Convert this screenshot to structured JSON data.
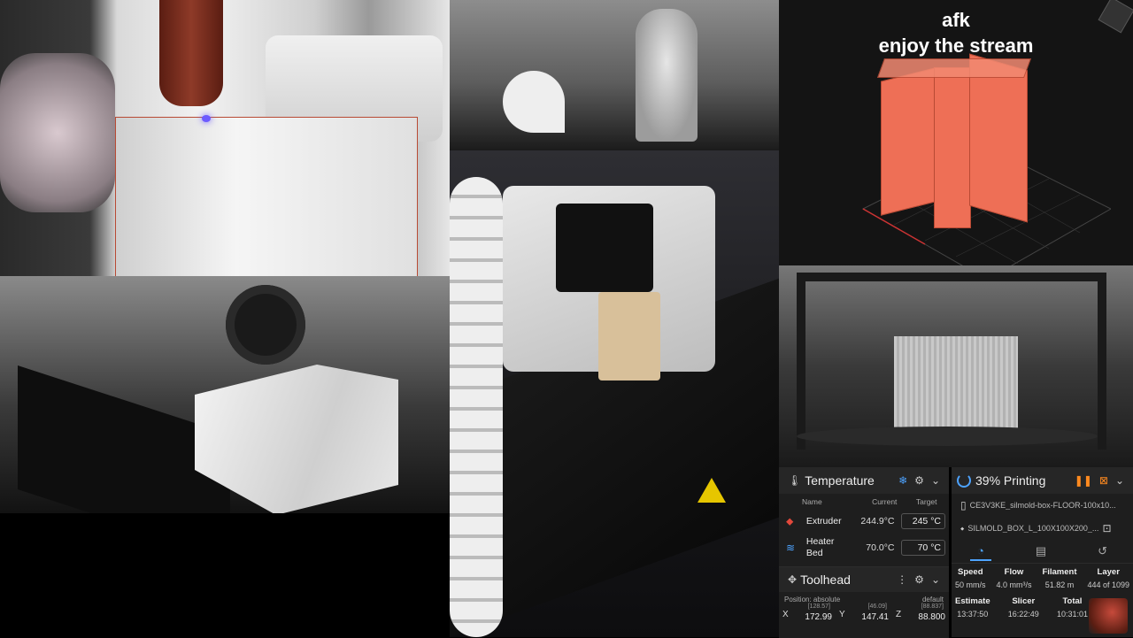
{
  "overlay": {
    "line1": "afk",
    "line2": "enjoy the stream"
  },
  "temperature": {
    "title": "Temperature",
    "headers": {
      "name": "Name",
      "current": "Current",
      "target": "Target"
    },
    "rows": [
      {
        "name": "Extruder",
        "current": "244.9°C",
        "target": "245",
        "unit": "°C"
      },
      {
        "name": "Heater Bed",
        "current": "70.0°C",
        "target": "70",
        "unit": "°C"
      }
    ]
  },
  "toolhead": {
    "title": "Toolhead",
    "position_label": "Position: absolute",
    "profile": "default",
    "axes": [
      {
        "axis": "X",
        "requested": "[128.57]",
        "value": "172.99"
      },
      {
        "axis": "Y",
        "requested": "[46.09]",
        "value": "147.41"
      },
      {
        "axis": "Z",
        "requested": "[88.837]",
        "value": "88.800"
      }
    ]
  },
  "status": {
    "title": "39% Printing",
    "progress": 0.39,
    "file_gcode": "CE3V3KE_silmold-box-FLOOR-100x10...",
    "file_object": "SILMOLD_BOX_L_100X100X200_...",
    "stats1": [
      {
        "k": "Speed",
        "v": "50 mm/s"
      },
      {
        "k": "Flow",
        "v": "4.0 mm³/s"
      },
      {
        "k": "Filament",
        "v": "51.82 m"
      },
      {
        "k": "Layer",
        "v": "444 of 1099"
      }
    ],
    "stats2": [
      {
        "k": "Estimate",
        "v": "13:37:50"
      },
      {
        "k": "Slicer",
        "v": "16:22:49"
      },
      {
        "k": "Total",
        "v": "10:31:01"
      }
    ]
  },
  "colors": {
    "accent": "#4da3ff",
    "model": "#ee6f56",
    "warning": "#ff8a1f",
    "extruder": "#e2483b"
  },
  "icons": {
    "temperature": "thermometer-icon",
    "snowflake": "snowflake-icon",
    "gear": "gear-icon",
    "chevron": "chevron-down-icon",
    "extruder": "extruder-icon",
    "bed": "bed-icon",
    "toolhead": "move-icon",
    "pause": "pause-icon",
    "cancel": "cancel-icon"
  }
}
